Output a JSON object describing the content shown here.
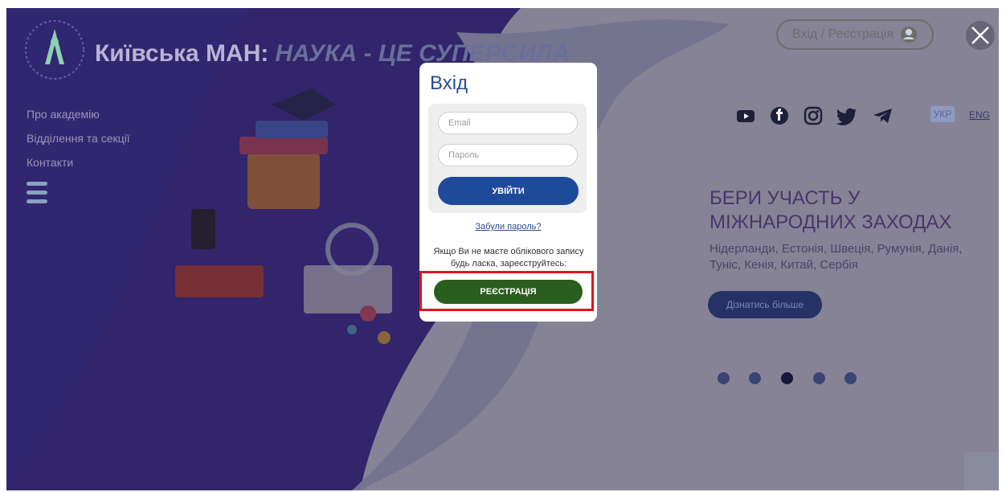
{
  "header": {
    "brand_name": "Київська МАН:",
    "brand_tagline": "НАУКА - ЦЕ СУПЕРСИЛА",
    "login_register": "Вхід / Реєстрація",
    "close_icon": "close-icon"
  },
  "sidebar": {
    "items": [
      {
        "label": "Про академію"
      },
      {
        "label": "Відділення та секції"
      },
      {
        "label": "Контакти"
      }
    ],
    "menu_icon": "hamburger-icon"
  },
  "social": {
    "icons": [
      "youtube-icon",
      "facebook-icon",
      "instagram-icon",
      "twitter-icon",
      "telegram-icon"
    ]
  },
  "languages": {
    "active": "УКР",
    "other": "ENG"
  },
  "promo": {
    "title": "БЕРИ УЧАСТЬ У МІЖНАРОДНИХ ЗАХОДАХ",
    "text": "Нідерланди, Естонія, Швеція, Румунія, Данія, Туніс, Кенія, Китай, Сербія",
    "button": "Дізнатись більше",
    "slides_total": 5,
    "active_slide": 3
  },
  "login_modal": {
    "title": "Вхід",
    "email_placeholder": "Email",
    "password_placeholder": "Пароль",
    "submit_label": "УВІЙТИ",
    "forgot_link": "Забули пароль?",
    "no_account_text": "Якщо Ви не маєте облікового запису будь ласка, зареєструйтесь:",
    "register_label": "РЕЄСТРАЦІЯ"
  },
  "colors": {
    "overlay": "#281c3c",
    "modal_title": "#2a4a98",
    "submit_button": "#1e4a9a",
    "register_button": "#2a5e1e",
    "highlight": "#e0141e"
  }
}
